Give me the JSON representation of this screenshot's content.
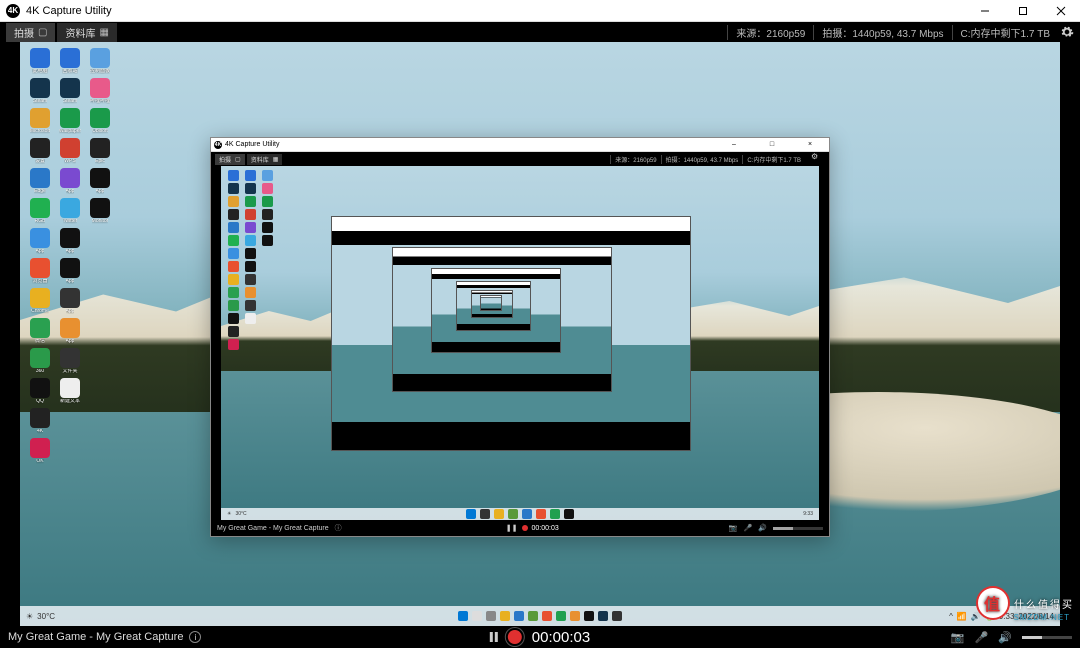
{
  "window": {
    "title": "4K Capture Utility",
    "icon_label": "4K"
  },
  "toolbar": {
    "tab_capture": "拍摄",
    "tab_capture_icon": "●",
    "tab_library": "资料库",
    "source_status": "来源：2160p59",
    "record_status": "拍摄：1440p59, 43.7 Mbps",
    "storage_status": "C:内存中剩下1.7 TB"
  },
  "footer": {
    "session": "My Great Game - My Great Capture",
    "timer": "00:00:03"
  },
  "inner": {
    "title": "4K Capture Utility",
    "tab_capture": "拍摄",
    "tab_library": "资料库",
    "source_status": "来源：2160p59",
    "record_status": "拍摄：1440p59, 43.7 Mbps",
    "storage_status": "C:内存中剩下1.7 TB",
    "session": "My Great Game - My Great Capture",
    "timer": "00:00:03"
  },
  "taskbar": {
    "weather": "30°C",
    "time": "9:33",
    "date": "2022/8/14"
  },
  "watermark": {
    "brand": "什么值得买",
    "site": "SMZDM.NET"
  },
  "desktop_icons": [
    [
      "此电脑",
      "回收站",
      "控制面板"
    ],
    [
      "Steam",
      "Steam",
      "哔哩哔哩"
    ],
    [
      "Microsoft",
      "Wallpaper",
      "Ubisoft"
    ],
    [
      "设置",
      "WPS",
      "Epic"
    ],
    [
      "Edge",
      "App",
      "App"
    ],
    [
      "RGB",
      "Twitter",
      "Monitor"
    ],
    [
      "App",
      "",
      ""
    ],
    [
      "浏览器",
      "App",
      ""
    ],
    [
      "Chrome",
      "App",
      ""
    ],
    [
      "微信",
      "App",
      ""
    ],
    [
      "360",
      "App",
      ""
    ],
    [
      "QQ",
      "文件夹",
      ""
    ],
    [
      "4K",
      "新建文本",
      ""
    ],
    [
      "OK",
      "",
      ""
    ]
  ],
  "icon_colors": [
    [
      "#2a6fd6",
      "#2a6fd6",
      "#5aa0e0"
    ],
    [
      "#14344c",
      "#14344c",
      "#e85a8a"
    ],
    [
      "#e0a030",
      "#1a9a4a",
      "#1a9a4a"
    ],
    [
      "#222",
      "#d04030",
      "#222"
    ],
    [
      "#2a78c8",
      "#7a4ad0",
      "#111"
    ],
    [
      "#20b050",
      "#3aa8e0",
      "#111"
    ],
    [
      "#3a90e0",
      "",
      ""
    ],
    [
      "#e85030",
      "#111",
      ""
    ],
    [
      "#e8b020",
      "#111",
      ""
    ],
    [
      "#2aa050",
      "#333",
      ""
    ],
    [
      "#2a9a4a",
      "#e89030",
      ""
    ],
    [
      "#111",
      "#333",
      ""
    ],
    [
      "#222",
      "#eee",
      ""
    ],
    [
      "#d02050",
      "",
      ""
    ]
  ]
}
